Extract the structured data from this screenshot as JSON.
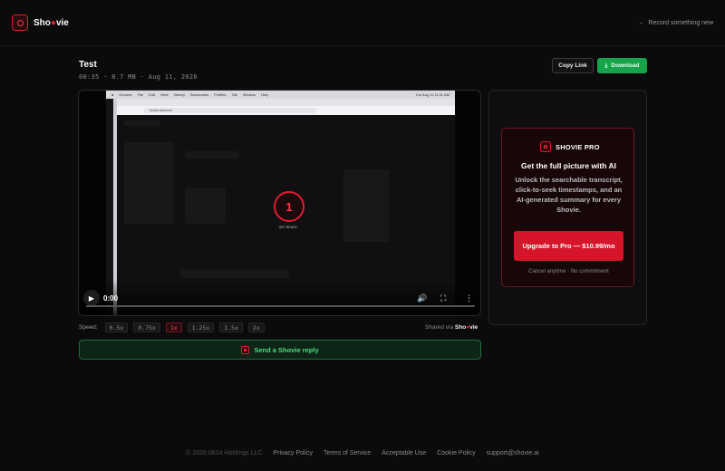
{
  "header": {
    "brand_prefix": "Sho",
    "brand_o": "●",
    "brand_suffix": "vie",
    "record_link": "Record something new",
    "record_icon": "arrow-left-icon"
  },
  "recording": {
    "title": "Test",
    "meta": "00:35 · 8.7 MB · Aug 11, 2026"
  },
  "actions": {
    "copy_link": "Copy Link",
    "download": "Download"
  },
  "player": {
    "current_time": "0:00",
    "countdown": "1",
    "overlay_text": "GET READY...",
    "screen_url": "shovie.ai/record",
    "mac_menu": [
      "Chrome",
      "File",
      "Edit",
      "View",
      "History",
      "Bookmarks",
      "Profiles",
      "Tab",
      "Window",
      "Help"
    ],
    "mac_clock": "Tue Aug 11  11:32 AM",
    "progress": 0
  },
  "speed": {
    "label": "Speed:",
    "options": [
      "0.5x",
      "0.75x",
      "1x",
      "1.25x",
      "1.5x",
      "2x"
    ],
    "selected": "1x"
  },
  "shared_via": {
    "prefix": "Shared via",
    "brand_prefix": "Sho",
    "brand_suffix": "vie"
  },
  "reply_button": "Send a Shovie reply",
  "pro": {
    "badge": "SHOVIE PRO",
    "title": "Get the full picture with AI",
    "body": "Unlock the searchable transcript, click-to-seek timestamps, and an AI-generated summary for every Shovie.",
    "cta": "Upgrade to Pro — $10.99/mo",
    "note": "Cancel anytime · No commitment"
  },
  "footer": {
    "copyright": "© 2026 0824 Holdings LLC",
    "links": [
      "Privacy Policy",
      "Terms of Service",
      "Acceptable Use",
      "Cookie Policy",
      "support@shovie.ai"
    ]
  },
  "colors": {
    "brand_red": "#e11d2e",
    "download_green": "#16a34a",
    "reply_green": "#4ade80"
  }
}
